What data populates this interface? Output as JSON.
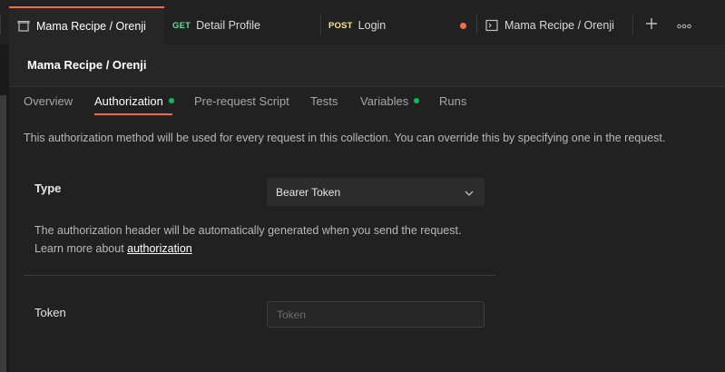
{
  "tabs": [
    {
      "label": "Mama Recipe / Orenji",
      "icon": "collection-icon",
      "active": true
    },
    {
      "method": "GET",
      "label": "Detail Profile"
    },
    {
      "method": "POST",
      "label": "Login",
      "unsaved": true
    },
    {
      "label": "Mama Recipe / Orenji",
      "icon": "environment-icon"
    }
  ],
  "toolbar": {
    "new_tab_icon": "plus-icon",
    "more_icon": "more-horizontal-icon"
  },
  "header": {
    "title": "Mama Recipe / Orenji"
  },
  "subtabs": [
    {
      "label": "Overview"
    },
    {
      "label": "Authorization",
      "active": true,
      "indicator": true
    },
    {
      "label": "Pre-request Script"
    },
    {
      "label": "Tests"
    },
    {
      "label": "Variables",
      "indicator": true
    },
    {
      "label": "Runs"
    }
  ],
  "auth": {
    "description": "This authorization method will be used for every request in this collection. You can override this by specifying one in the request.",
    "type_label": "Type",
    "type_value": "Bearer Token",
    "info_line1": "The authorization header will be automatically generated when you send the request.",
    "info_line2_prefix": "Learn more about ",
    "info_link": "authorization",
    "token_label": "Token",
    "token_placeholder": "Token",
    "token_value": ""
  },
  "colors": {
    "accent": "#f26b3a",
    "get": "#6bdd9a",
    "post": "#ffe47e",
    "indicator": "#0cbb52",
    "unsaved": "#ff6c37"
  }
}
